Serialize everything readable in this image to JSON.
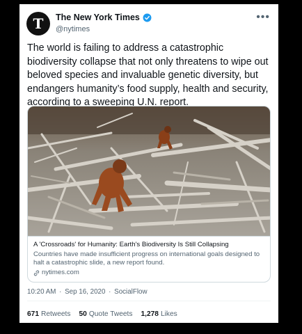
{
  "account": {
    "display_name": "The New York Times",
    "handle": "@nytimes",
    "verified_icon": "verified-badge-icon",
    "avatar_icon": "nyt-logo-icon"
  },
  "tweet": {
    "text": "The world is failing to address a catastrophic biodiversity collapse that not only threatens to wipe out beloved species and invaluable genetic diversity, but endangers humanity’s food supply, health and security, according to a sweeping U.N. report."
  },
  "link_card": {
    "title": "A 'Crossroads' for Humanity: Earth's Biodiversity Is Still Collapsing",
    "description": "Countries have made insufficient progress on international goals designed to halt a catastrophic slide, a new report found.",
    "domain": "nytimes.com",
    "domain_icon": "link-icon"
  },
  "meta": {
    "time": "10:20 AM",
    "date": "Sep 16, 2020",
    "source": "SocialFlow",
    "separator": "·"
  },
  "stats": {
    "retweets_count": "671",
    "retweets_label": "Retweets",
    "quotes_count": "50",
    "quotes_label": "Quote Tweets",
    "likes_count": "1,278",
    "likes_label": "Likes"
  },
  "more_icon": "more-options-icon",
  "colors": {
    "background": "#000000",
    "card": "#ffffff",
    "verified": "#1d9bf0",
    "text": "#0f1419",
    "secondary": "#536471"
  }
}
